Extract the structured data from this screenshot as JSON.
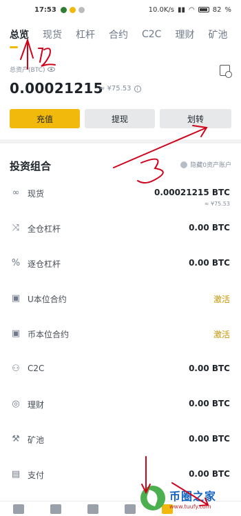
{
  "status_bar": {
    "time": "17:53",
    "speed": "10.0K/s",
    "battery": "82"
  },
  "tabs": [
    {
      "label": "总览",
      "active": true
    },
    {
      "label": "现货"
    },
    {
      "label": "杠杆"
    },
    {
      "label": "合约"
    },
    {
      "label": "C2C"
    },
    {
      "label": "理财"
    },
    {
      "label": "矿池"
    }
  ],
  "asset": {
    "label": "总资产(BTC)",
    "balance": "0.00021215",
    "fiat": "≈ ¥75.53"
  },
  "actions": {
    "deposit": "充值",
    "withdraw": "提现",
    "transfer": "划转"
  },
  "portfolio": {
    "title": "投资组合",
    "hide_zero": "隐藏0资产账户",
    "rows": [
      {
        "icon": "spot-icon",
        "name": "现货",
        "value": "0.00021215 BTC",
        "sub": "≈ ¥75.53"
      },
      {
        "icon": "cross-margin-icon",
        "name": "全仓杠杆",
        "value": "0.00 BTC"
      },
      {
        "icon": "isolated-margin-icon",
        "name": "逐仓杠杆",
        "value": "0.00 BTC"
      },
      {
        "icon": "usdt-futures-icon",
        "name": "U本位合约",
        "value": "激活"
      },
      {
        "icon": "coin-futures-icon",
        "name": "币本位合约",
        "value": "激活"
      },
      {
        "icon": "c2c-icon",
        "name": "C2C",
        "value": "0.00 BTC"
      },
      {
        "icon": "earn-icon",
        "name": "理财",
        "value": "0.00 BTC"
      },
      {
        "icon": "pool-icon",
        "name": "矿池",
        "value": "0.00 BTC"
      },
      {
        "icon": "pay-icon",
        "name": "支付",
        "value": "0.00 BTC"
      }
    ]
  },
  "watermark": {
    "title": "币圈之家",
    "url": "www.tuufy.com"
  },
  "colors": {
    "accent": "#f0b90b",
    "annotation": "#d0021b"
  }
}
